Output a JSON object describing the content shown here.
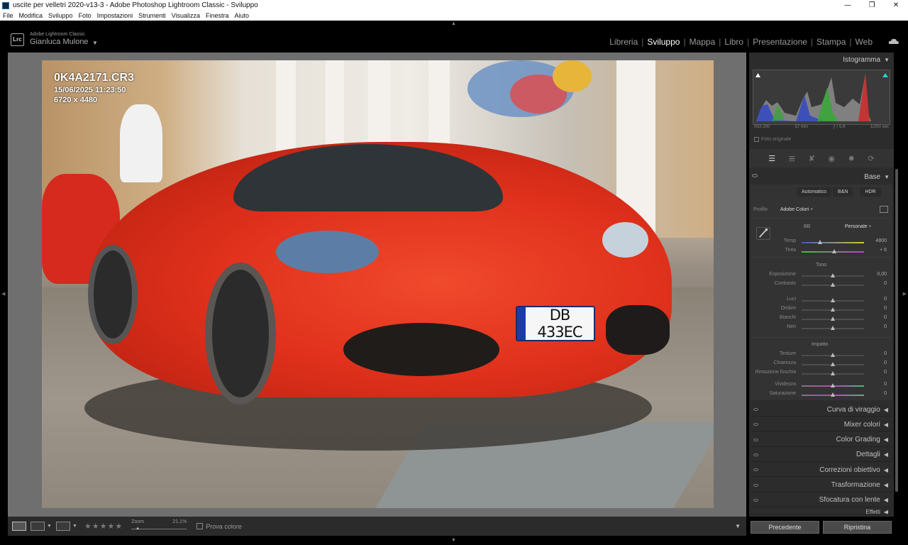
{
  "window": {
    "title": "uscite per velletri 2020-v13-3 - Adobe Photoshop Lightroom Classic - Sviluppo"
  },
  "menu": [
    "File",
    "Modifica",
    "Sviluppo",
    "Foto",
    "Impostazioni",
    "Strumenti",
    "Visualizza",
    "Finestra",
    "Aiuto"
  ],
  "identity": {
    "app_name": "Adobe Lightroom Classic",
    "user": "Gianluca Mulone",
    "logo": "Lrc"
  },
  "modules": [
    "Libreria",
    "Sviluppo",
    "Mappa",
    "Libro",
    "Presentazione",
    "Stampa",
    "Web"
  ],
  "active_module": "Sviluppo",
  "photo": {
    "filename": "0K4A2171.CR3",
    "datetime": "15/06/2025 11:23:50",
    "dimensions": "6720 x 4480",
    "plate": "DB 433EC"
  },
  "toolbar": {
    "zoom_label": "Zoom",
    "zoom_value": "21,1%",
    "softproof_label": "Prova colore",
    "stars": "★★★★★"
  },
  "histogram": {
    "title": "Istogramma",
    "iso": "ISO 200",
    "focal": "57 mm",
    "aperture": "ƒ / 5,6",
    "shutter": "1/250 sec",
    "original_photo": "Foto originale"
  },
  "base": {
    "title": "Base",
    "modes": [
      "Automatico",
      "B&N",
      "HDR"
    ],
    "profile_label": "Profilo",
    "profile_value": "Adobe Colori ÷",
    "wb_label": "BB",
    "wb_value": "Personale ÷",
    "sliders_wb": [
      {
        "label": "Temp",
        "value": "4800",
        "pos": 0.3,
        "gradient": "linear-gradient(90deg,#3a5ad0,#d9c830)"
      },
      {
        "label": "Tinta",
        "value": "+ 6",
        "pos": 0.52,
        "gradient": "linear-gradient(90deg,#3fbf3f,#c03fc0)"
      }
    ],
    "tone_label": "Tono",
    "sliders_tone": [
      {
        "label": "Esposizione",
        "value": "0,00",
        "pos": 0.5
      },
      {
        "label": "Contrasto",
        "value": "0",
        "pos": 0.5
      }
    ],
    "sliders_tone2": [
      {
        "label": "Luci",
        "value": "0",
        "pos": 0.5
      },
      {
        "label": "Ombre",
        "value": "0",
        "pos": 0.5
      },
      {
        "label": "Bianchi",
        "value": "0",
        "pos": 0.5
      },
      {
        "label": "Neri",
        "value": "0",
        "pos": 0.5
      }
    ],
    "impact_label": "Impatto",
    "sliders_impact": [
      {
        "label": "Texture",
        "value": "0",
        "pos": 0.5
      },
      {
        "label": "Chiarezza",
        "value": "0",
        "pos": 0.5
      },
      {
        "label": "Rimozione foschia",
        "value": "0",
        "pos": 0.5
      }
    ],
    "sliders_color": [
      {
        "label": "Vividezza",
        "value": "0",
        "pos": 0.5,
        "gradient": "linear-gradient(90deg,#777,#c23fbf,#3fbf7f)"
      },
      {
        "label": "Saturazione",
        "value": "0",
        "pos": 0.5,
        "gradient": "linear-gradient(90deg,#777,#c23fbf,#3fbf7f)"
      }
    ]
  },
  "collapsed_panels": [
    "Curva di viraggio",
    "Mixer colori",
    "Color Grading",
    "Dettagli",
    "Correzioni obiettivo",
    "Trasformazione",
    "Sfocatura con lente",
    "Effetti"
  ],
  "buttons": {
    "previous": "Precedente",
    "reset": "Ripristina"
  }
}
